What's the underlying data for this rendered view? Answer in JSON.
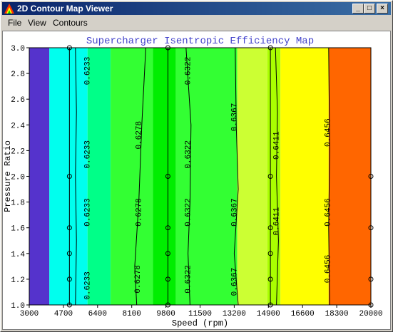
{
  "window": {
    "title": "2D Contour Map Viewer",
    "controls": {
      "minimize": "_",
      "maximize": "□",
      "close": "×"
    }
  },
  "menu": {
    "items": [
      {
        "label": "File"
      },
      {
        "label": "View"
      },
      {
        "label": "Contours"
      }
    ]
  },
  "chart_data": {
    "type": "heatmap",
    "title": "Supercharger Isentropic Efficiency Map",
    "xlabel": "Speed (rpm)",
    "ylabel": "Pressure Ratio",
    "xlim": [
      3000,
      20000
    ],
    "ylim": [
      1.0,
      3.0
    ],
    "x_ticks": [
      "3000",
      "4700",
      "6400",
      "8100",
      "9800",
      "11500",
      "13200",
      "14900",
      "16600",
      "18300",
      "20000"
    ],
    "y_ticks": [
      "1.0",
      "1.2",
      "1.4",
      "1.6",
      "1.8",
      "2.0",
      "2.2",
      "2.4",
      "2.6",
      "2.8",
      "3.0"
    ],
    "bands": [
      {
        "x_from": 3000,
        "x_to": 4000,
        "color": "#5533cc"
      },
      {
        "x_from": 4000,
        "x_to": 5900,
        "color": "#00ffee"
      },
      {
        "x_from": 5900,
        "x_to": 7050,
        "color": "#00ff88"
      },
      {
        "x_from": 7050,
        "x_to": 9150,
        "color": "#33ff33"
      },
      {
        "x_from": 9150,
        "x_to": 10300,
        "color": "#00ee00"
      },
      {
        "x_from": 10300,
        "x_to": 13350,
        "color": "#33ff33"
      },
      {
        "x_from": 13350,
        "x_to": 14850,
        "color": "#ccff33"
      },
      {
        "x_from": 14850,
        "x_to": 15500,
        "color": "#aaff00"
      },
      {
        "x_from": 15500,
        "x_to": 17900,
        "color": "#ffff00"
      },
      {
        "x_from": 17900,
        "x_to": 20000,
        "color": "#ff6600"
      }
    ],
    "contours": [
      {
        "level": "0.6233",
        "points": [
          [
            5300,
            1.0
          ],
          [
            5350,
            1.5
          ],
          [
            5300,
            2.0
          ],
          [
            5350,
            2.5
          ],
          [
            5300,
            3.0
          ]
        ]
      },
      {
        "level": "0.6278",
        "points": [
          [
            8350,
            1.0
          ],
          [
            8250,
            1.3
          ],
          [
            8450,
            1.8
          ],
          [
            8600,
            2.4
          ],
          [
            8800,
            3.0
          ]
        ]
      },
      {
        "level": "0.6322",
        "points": [
          [
            11000,
            1.0
          ],
          [
            10900,
            1.4
          ],
          [
            11000,
            1.8
          ],
          [
            11050,
            2.4
          ],
          [
            10800,
            3.0
          ]
        ]
      },
      {
        "level": "0.6367",
        "points": [
          [
            13400,
            1.0
          ],
          [
            13200,
            1.4
          ],
          [
            13400,
            1.9
          ],
          [
            13300,
            2.4
          ],
          [
            13250,
            3.0
          ]
        ]
      },
      {
        "level": "0.6411",
        "points": [
          [
            15300,
            1.0
          ],
          [
            15400,
            1.5
          ],
          [
            15300,
            2.0
          ],
          [
            15350,
            2.5
          ],
          [
            15250,
            3.0
          ]
        ]
      },
      {
        "level": "0.6456",
        "points": [
          [
            17950,
            1.0
          ],
          [
            17900,
            1.6
          ],
          [
            17950,
            2.2
          ],
          [
            17900,
            3.0
          ]
        ]
      }
    ],
    "contour_labels": [
      {
        "text": "0.6233",
        "x": 5900,
        "y": 2.82
      },
      {
        "text": "0.6233",
        "x": 5900,
        "y": 2.17
      },
      {
        "text": "0.6233",
        "x": 5900,
        "y": 1.72
      },
      {
        "text": "0.6233",
        "x": 5900,
        "y": 1.15
      },
      {
        "text": "0.6278",
        "x": 8450,
        "y": 2.32
      },
      {
        "text": "0.6278",
        "x": 8450,
        "y": 1.72
      },
      {
        "text": "0.6278",
        "x": 8400,
        "y": 1.2
      },
      {
        "text": "0.6322",
        "x": 10900,
        "y": 2.82
      },
      {
        "text": "0.6322",
        "x": 10900,
        "y": 2.17
      },
      {
        "text": "0.6322",
        "x": 10900,
        "y": 1.72
      },
      {
        "text": "0.6322",
        "x": 10900,
        "y": 1.2
      },
      {
        "text": "0.6367",
        "x": 13200,
        "y": 2.46
      },
      {
        "text": "0.6367",
        "x": 13200,
        "y": 1.72
      },
      {
        "text": "0.6367",
        "x": 13200,
        "y": 1.18
      },
      {
        "text": "0.6411",
        "x": 15300,
        "y": 2.24
      },
      {
        "text": "0.6411",
        "x": 15300,
        "y": 1.65
      },
      {
        "text": "0.6456",
        "x": 17850,
        "y": 2.34
      },
      {
        "text": "0.6456",
        "x": 17850,
        "y": 1.72
      },
      {
        "text": "0.6456",
        "x": 17850,
        "y": 1.28
      }
    ],
    "grid_lines_x": [
      5000,
      9900,
      15000
    ],
    "grid_markers": [
      [
        5000,
        1.0
      ],
      [
        5000,
        1.2
      ],
      [
        5000,
        1.4
      ],
      [
        5000,
        1.6
      ],
      [
        5000,
        2.0
      ],
      [
        5000,
        3.0
      ],
      [
        9900,
        1.0
      ],
      [
        9900,
        1.2
      ],
      [
        9900,
        1.4
      ],
      [
        9900,
        1.6
      ],
      [
        9900,
        2.0
      ],
      [
        9900,
        3.0
      ],
      [
        15000,
        1.0
      ],
      [
        15000,
        1.2
      ],
      [
        15000,
        1.4
      ],
      [
        15000,
        1.6
      ],
      [
        15000,
        2.0
      ],
      [
        15000,
        3.0
      ],
      [
        20000,
        1.0
      ],
      [
        20000,
        1.2
      ],
      [
        20000,
        1.6
      ],
      [
        20000,
        2.0
      ]
    ],
    "colors": {
      "title": "#4444cc",
      "contour": "#000000"
    }
  }
}
